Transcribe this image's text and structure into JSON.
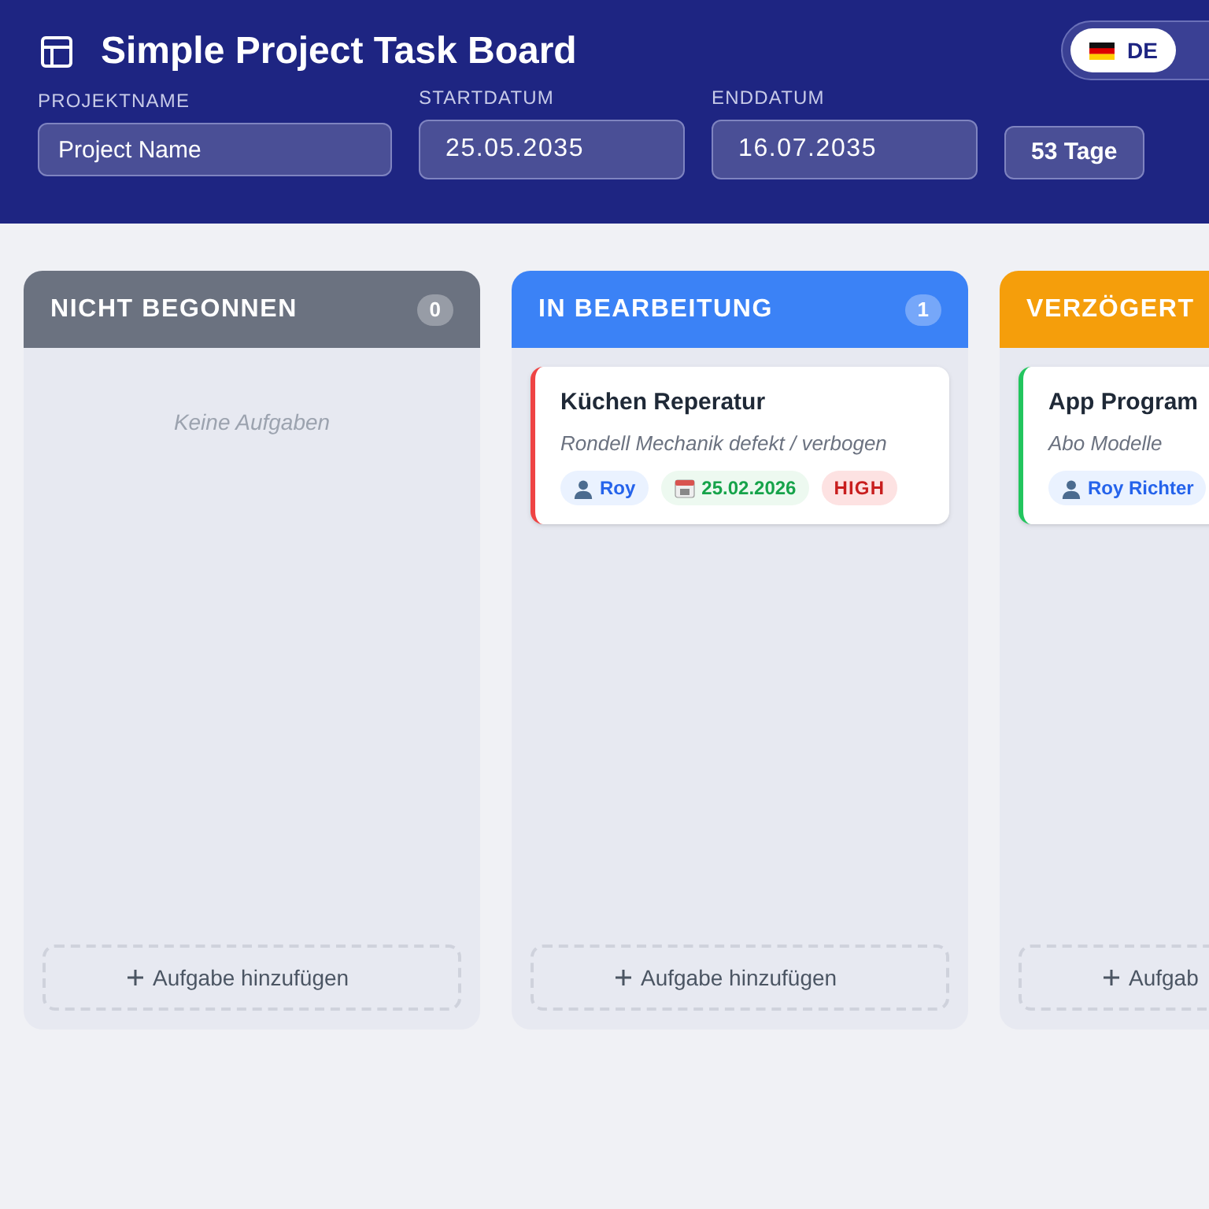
{
  "header": {
    "title": "Simple Project Task Board",
    "language": {
      "label": "DE",
      "selected": true
    }
  },
  "fields": [
    {
      "kind": "text",
      "label": "PROJEKTNAME",
      "value": "Project Name"
    },
    {
      "kind": "date",
      "label": "STARTDATUM",
      "value": "25.05.2035"
    },
    {
      "kind": "date",
      "label": "ENDDATUM",
      "value": "16.07.2035"
    }
  ],
  "duration": "53 Tage",
  "columns": [
    {
      "title": "NICHT BEGONNEN",
      "count": "0",
      "color": "#6b7280",
      "empty_text": "Keine Aufgaben",
      "add_label": "Aufgabe hinzufügen"
    },
    {
      "title": "IN BEARBEITUNG",
      "count": "1",
      "color": "#3b82f6",
      "tasks": [
        {
          "title": "Küchen Reperatur",
          "description": "Rondell Mechanik defekt / verbogen",
          "color": "#ef4444",
          "assignee": "Roy",
          "due": "25.02.2026",
          "priority": "HIGH"
        }
      ],
      "add_label": "Aufgabe hinzufügen"
    },
    {
      "title": "VERZÖGERT",
      "color": "#f59e0b",
      "tasks": [
        {
          "title": "App Program",
          "description": "Abo Modelle",
          "color": "#22c55e",
          "assignee": "Roy Richter"
        }
      ],
      "add_label": "Aufgab"
    }
  ]
}
